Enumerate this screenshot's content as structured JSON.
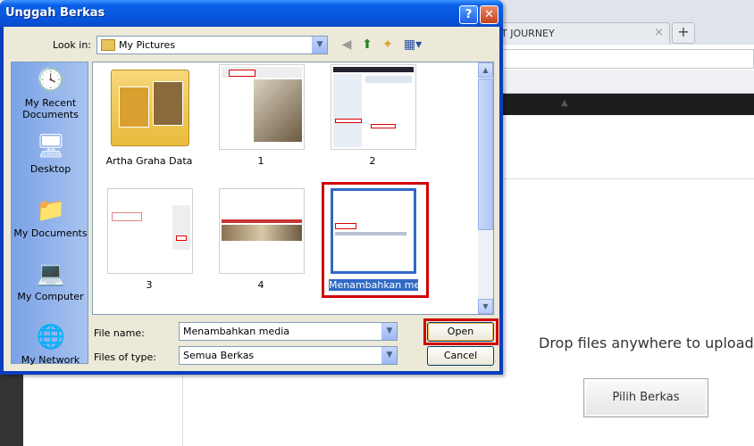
{
  "browser": {
    "tab_title": "T JOURNEY",
    "tab_close": "×",
    "new_tab": "+",
    "admin_caret": "▲"
  },
  "page": {
    "drop_text": "Drop files anywhere to upload",
    "pick_button": "Pilih Berkas"
  },
  "dialog": {
    "title": "Unggah Berkas",
    "help_button": "?",
    "close_button": "✕",
    "look_in_label": "Look in:",
    "look_in_value": "My Pictures",
    "places": [
      {
        "label": "My Recent Documents",
        "icon": "recent-documents-icon"
      },
      {
        "label": "Desktop",
        "icon": "desktop-icon"
      },
      {
        "label": "My Documents",
        "icon": "my-documents-icon"
      },
      {
        "label": "My Computer",
        "icon": "my-computer-icon"
      },
      {
        "label": "My Network",
        "icon": "my-network-icon"
      }
    ],
    "files": [
      {
        "name": "Artha Graha Data",
        "kind": "folder"
      },
      {
        "name": "1",
        "kind": "image"
      },
      {
        "name": "2",
        "kind": "image"
      },
      {
        "name": "3",
        "kind": "image"
      },
      {
        "name": "4",
        "kind": "image"
      },
      {
        "name": "Menambahkan media",
        "kind": "image",
        "selected": true
      }
    ],
    "file_name_label": "File name:",
    "file_name_value": "Menambahkan media",
    "file_type_label": "Files of type:",
    "file_type_value": "Semua Berkas",
    "open_button": "Open",
    "cancel_button": "Cancel"
  },
  "colors": {
    "titlebar": "#0855dd",
    "highlight_red": "#d00000",
    "selection_blue": "#316ac5",
    "dialog_bg": "#ece9d8"
  },
  "symbols": {
    "dropdown": "▼",
    "scroll_up": "▲",
    "scroll_down": "▼"
  }
}
